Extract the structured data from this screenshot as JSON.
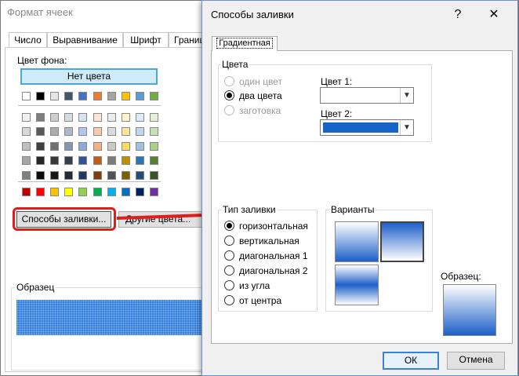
{
  "format_cells": {
    "title": "Формат ячеек",
    "tabs": [
      "Число",
      "Выравнивание",
      "Шрифт",
      "Границ"
    ],
    "bg_color_label": "Цвет фона:",
    "no_color": "Нет цвета",
    "fill_effects_button": "Способы заливки...",
    "more_colors_button": "Другие цвета...",
    "sample_label": "Образец",
    "theme_top_row": [
      "#ffffff",
      "#000000",
      "#e7e6e6",
      "#44546a",
      "#4472c4",
      "#ed7d31",
      "#a5a5a5",
      "#ffc000",
      "#5b9bd5",
      "#70ad47"
    ],
    "tint_rows": [
      [
        "#f2f2f2",
        "#7f7f7f",
        "#d0cece",
        "#d6dce4",
        "#d9e2f3",
        "#fbe5d5",
        "#ededed",
        "#fff2cc",
        "#deebf6",
        "#e2efd9"
      ],
      [
        "#d8d8d8",
        "#595959",
        "#aeabab",
        "#adb9ca",
        "#b4c6e7",
        "#f7cbac",
        "#dbdbdb",
        "#fee599",
        "#bdd7ee",
        "#c5e0b3"
      ],
      [
        "#bfbfbf",
        "#3f3f3f",
        "#757070",
        "#8496b0",
        "#8eaadb",
        "#f4b183",
        "#c9c9c9",
        "#ffd965",
        "#9cc3e5",
        "#a8d08d"
      ],
      [
        "#a5a5a5",
        "#262626",
        "#3a3838",
        "#323f4f",
        "#2f5496",
        "#c55a11",
        "#7b7b7b",
        "#bf8f00",
        "#2e75b5",
        "#538135"
      ],
      [
        "#7f7f7f",
        "#0c0c0c",
        "#171616",
        "#222a35",
        "#1f3864",
        "#833c0b",
        "#525252",
        "#7f6000",
        "#1e4e79",
        "#375623"
      ]
    ],
    "standard_row": [
      "#c00000",
      "#ff0000",
      "#ffc000",
      "#ffff00",
      "#92d050",
      "#00b050",
      "#00b0f0",
      "#0070c0",
      "#002060",
      "#7030a0"
    ],
    "sample_color": "#1f6fd8",
    "highlight_color": "#e11c1c"
  },
  "fill_dialog": {
    "title": "Способы заливки",
    "help": "?",
    "close": "✕",
    "tab": "Градиентная",
    "colors_group": "Цвета",
    "color_modes": [
      "один цвет",
      "два цвета",
      "заготовка"
    ],
    "color1_label": "Цвет 1:",
    "color2_label": "Цвет 2:",
    "color2_value": "#1565c8",
    "shading_group": "Тип заливки",
    "shading_styles": [
      "горизонтальная",
      "вертикальная",
      "диагональная 1",
      "диагональная 2",
      "из угла",
      "от центра"
    ],
    "variants_group": "Варианты",
    "sample_label": "Образец:",
    "ok": "ОК",
    "cancel": "Отмена"
  }
}
